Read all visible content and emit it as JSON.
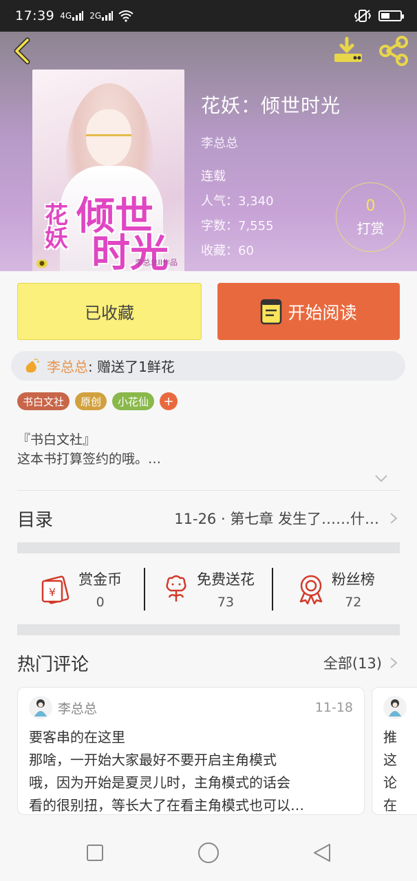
{
  "status_bar": {
    "time": "17:39",
    "signal1": "4G",
    "signal2": "2G"
  },
  "book": {
    "title": "花妖：倾世时光",
    "author": "李总总",
    "status": "连载",
    "popularity": "人气：3,340",
    "word_count": "字数：7,555",
    "favorites": "收藏：60",
    "cover_title_small": "花妖",
    "cover_title_big1": "倾世",
    "cover_title_big2": "时光",
    "cover_author": "李总总II作品"
  },
  "reward": {
    "count": "0",
    "label": "打赏"
  },
  "actions": {
    "collect_label": "已收藏",
    "read_label": "开始阅读"
  },
  "gift": {
    "user": "李总总",
    "text": ": 赠送了1鲜花"
  },
  "tags": [
    {
      "label": "书白文社",
      "color": "#c8664a"
    },
    {
      "label": "原创",
      "color": "#d2a13f"
    },
    {
      "label": "小花仙",
      "color": "#8ab84b"
    }
  ],
  "intro": {
    "line1": "『书白文社』",
    "line2": "这本书打算签约的哦。…"
  },
  "toc": {
    "label": "目录",
    "latest": "11-26 · 第七章 发生了……什…"
  },
  "stats": [
    {
      "name": "赏金币",
      "value": "0"
    },
    {
      "name": "免费送花",
      "value": "73"
    },
    {
      "name": "粉丝榜",
      "value": "72"
    }
  ],
  "comments_section": {
    "label": "热门评论",
    "all_label": "全部(13)"
  },
  "comments": [
    {
      "user": "李总总",
      "date": "11-18",
      "lines": [
        "要客串的在这里",
        "那啥，一开始大家最好不要开启主角模式",
        "哦，因为开始是夏灵儿时，主角模式的话会",
        "看的很别扭，等长大了在看主角模式也可以…"
      ]
    },
    {
      "user": "",
      "date": "",
      "lines": [
        "推",
        "这",
        "论",
        "在"
      ]
    }
  ],
  "colors": {
    "accent": "#e9693e",
    "collect_bg": "#fbf07c",
    "gift_name": "#e9934a",
    "stat_icon": "#d23a2a"
  }
}
